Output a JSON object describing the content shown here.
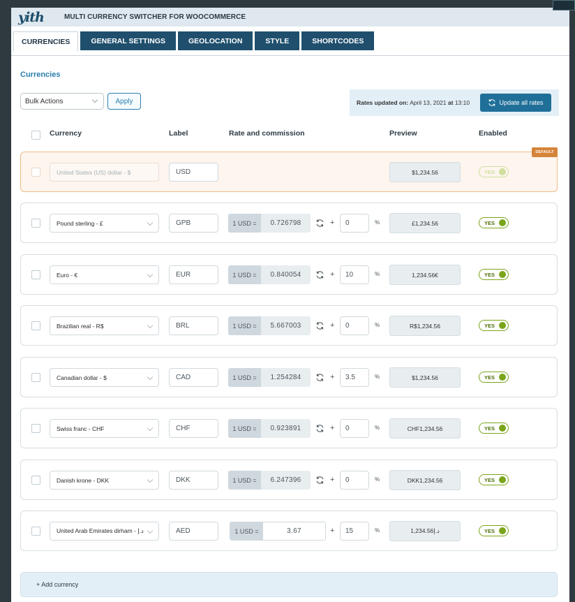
{
  "header": {
    "logo_text": "yith",
    "plugin_title": "MULTI CURRENCY SWITCHER FOR WOOCOMMERCE"
  },
  "tabs": [
    {
      "label": "CURRENCIES",
      "active": true
    },
    {
      "label": "GENERAL SETTINGS",
      "active": false
    },
    {
      "label": "GEOLOCATION",
      "active": false
    },
    {
      "label": "STYLE",
      "active": false
    },
    {
      "label": "SHORTCODES",
      "active": false
    }
  ],
  "section_title": "Currencies",
  "bulk_actions": {
    "selected": "Bulk Actions",
    "apply_label": "Apply"
  },
  "rates": {
    "updated_label": "Rates updated on:",
    "updated_date": "April 13, 2021",
    "at_label": "at",
    "updated_time": "13:10",
    "update_button_label": "Update all rates"
  },
  "columns": {
    "currency": "Currency",
    "label": "Label",
    "rate_commission": "Rate and commission",
    "preview": "Preview",
    "enabled": "Enabled"
  },
  "default_badge": "DEFAULT",
  "rate_prefix": "1 USD =",
  "percent_sign": "%",
  "plus_sign": "+",
  "currencies": [
    {
      "name": "United States (US) dollar - $",
      "label": "USD",
      "preview": "$1,234.56",
      "enabled": "YES"
    },
    {
      "name": "Pound sterling - £",
      "label": "GPB",
      "rate": "0.726798",
      "commission": "0",
      "preview": "£1,234.56",
      "enabled": "YES"
    },
    {
      "name": "Euro - €",
      "label": "EUR",
      "rate": "0.840054",
      "commission": "10",
      "preview": "1,234.56€",
      "enabled": "YES"
    },
    {
      "name": "Brazilian real - R$",
      "label": "BRL",
      "rate": "5.667003",
      "commission": "0",
      "preview": "R$1,234.56",
      "enabled": "YES"
    },
    {
      "name": "Canadian dollar - $",
      "label": "CAD",
      "rate": "1.254284",
      "commission": "3.5",
      "preview": "$1,234.56",
      "enabled": "YES"
    },
    {
      "name": "Swiss franc - CHF",
      "label": "CHF",
      "rate": "0.923891",
      "commission": "0",
      "preview": "CHF1,234.56",
      "enabled": "YES"
    },
    {
      "name": "Danish krone - DKK",
      "label": "DKK",
      "rate": "6.247396",
      "commission": "0",
      "preview": "DKK1,234.56",
      "enabled": "YES"
    },
    {
      "name": "United Arab Emirates dirham - د.إ",
      "label": "AED",
      "rate": "3.67",
      "commission": "15",
      "preview": "د.إ1,234.56",
      "enabled": "YES"
    }
  ],
  "add_currency_label": "+ Add currency"
}
